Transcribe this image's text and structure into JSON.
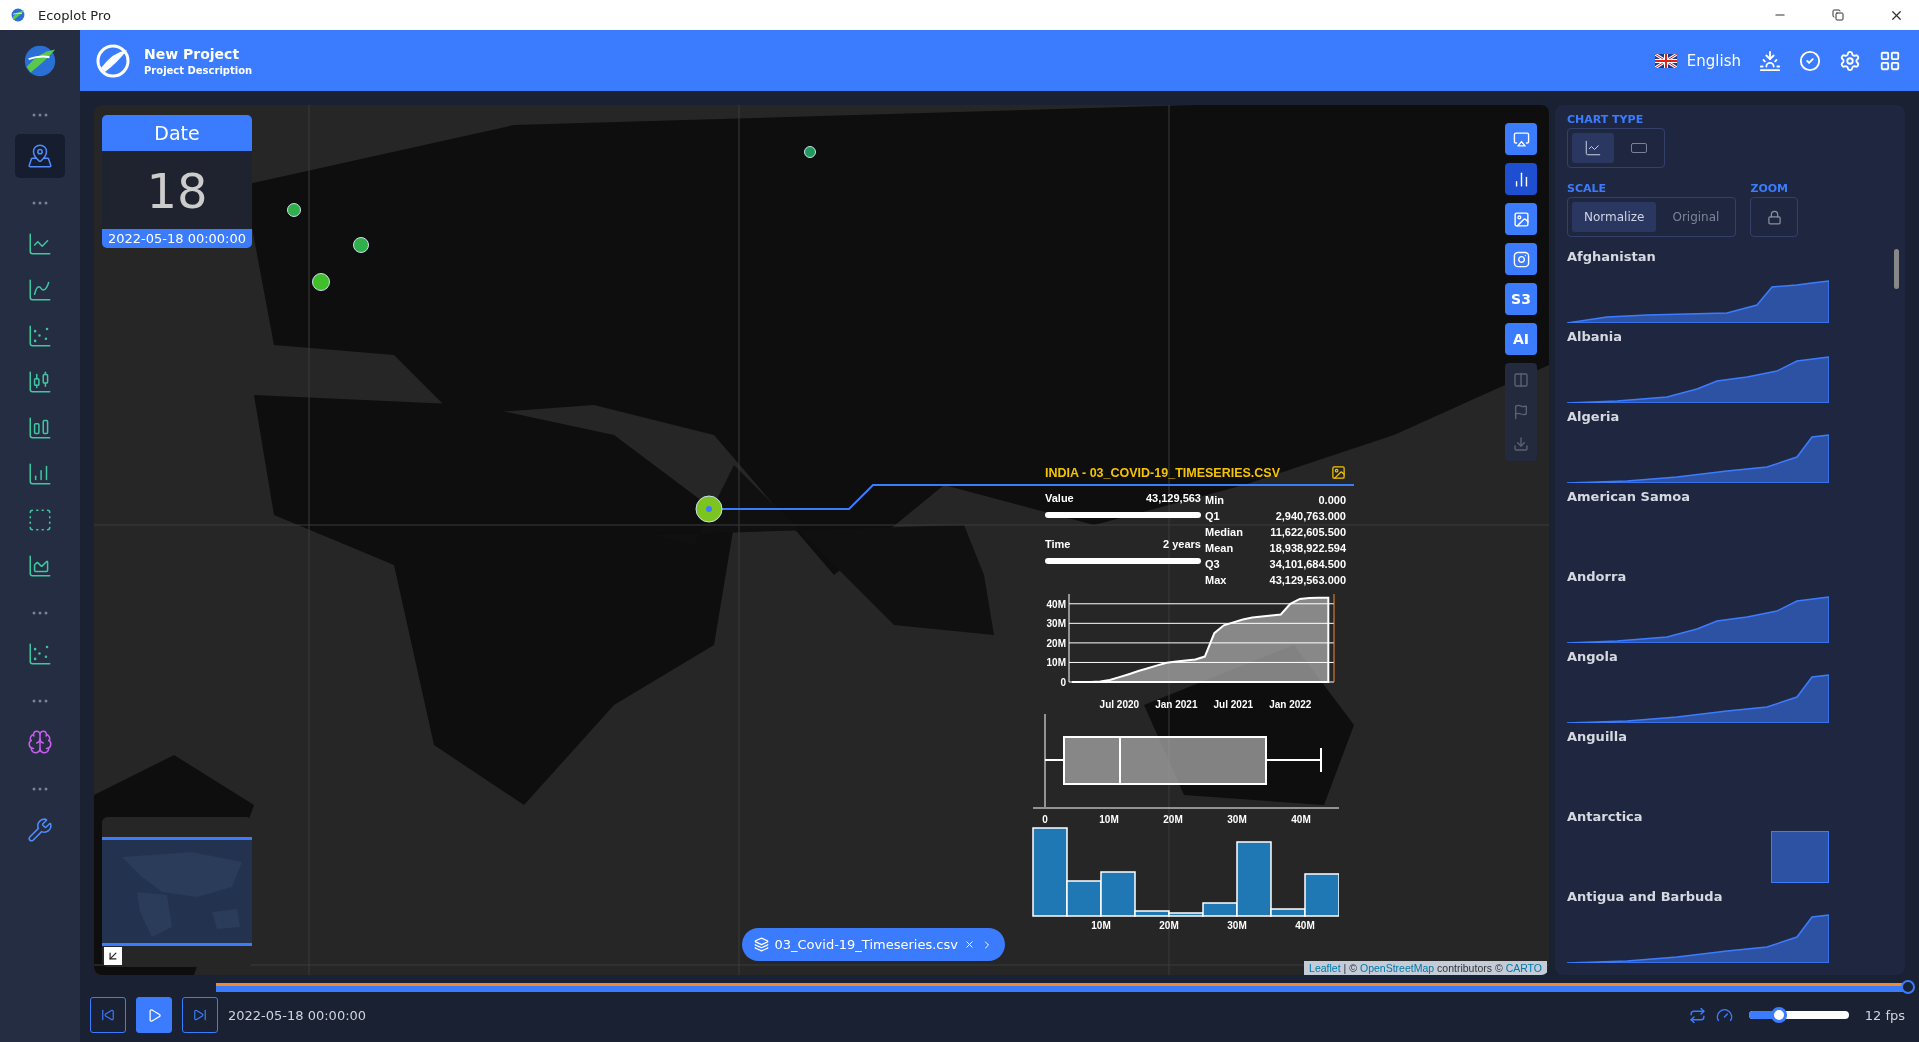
{
  "window": {
    "title": "Ecoplot Pro"
  },
  "sidebar": {
    "groups": [
      {
        "items": [
          {
            "selected": true
          }
        ]
      },
      {
        "items": [
          {
            "selected": false
          },
          {
            "selected": false
          },
          {
            "selected": false
          },
          {
            "selected": false
          },
          {
            "selected": false
          },
          {
            "selected": false
          },
          {
            "selected": false
          },
          {
            "selected": false
          }
        ]
      },
      {
        "items": [
          {
            "selected": false
          }
        ]
      },
      {
        "items": [
          {
            "selected": false
          }
        ]
      },
      {
        "items": [
          {
            "selected": false
          }
        ]
      }
    ]
  },
  "header": {
    "title": "New Project",
    "subtitle": "Project Description",
    "language": "English"
  },
  "date_card": {
    "label": "Date",
    "day": "18",
    "datetime": "2022-05-18 00:00:00"
  },
  "map_tools": [
    {
      "kind": "icon",
      "selected": false,
      "disabled": false
    },
    {
      "kind": "icon",
      "selected": true,
      "disabled": false
    },
    {
      "kind": "icon",
      "selected": false,
      "disabled": false
    },
    {
      "kind": "icon",
      "selected": false,
      "disabled": false
    },
    {
      "kind": "text",
      "label": "S3",
      "selected": false,
      "disabled": false
    },
    {
      "kind": "text",
      "label": "AI",
      "selected": false,
      "disabled": false
    },
    {
      "kind": "icon",
      "selected": false,
      "disabled": true
    },
    {
      "kind": "icon",
      "selected": false,
      "disabled": true
    },
    {
      "kind": "icon",
      "selected": false,
      "disabled": true
    }
  ],
  "tooltip": {
    "title": "INDIA - 03_COVID-19_TIMESERIES.CSV",
    "value_label": "Value",
    "value": "43,129,563",
    "time_label": "Time",
    "time": "2 years",
    "stats": [
      {
        "label": "Min",
        "value": "0.000"
      },
      {
        "label": "Q1",
        "value": "2,940,763.000"
      },
      {
        "label": "Median",
        "value": "11,622,605.500"
      },
      {
        "label": "Mean",
        "value": "18,938,922.594"
      },
      {
        "label": "Q3",
        "value": "34,101,684.500"
      },
      {
        "label": "Max",
        "value": "43,129,563.000"
      }
    ],
    "chart_data": {
      "type": "area",
      "categories": [
        null,
        null,
        null,
        null,
        null,
        "Jul 2020",
        null,
        null,
        null,
        null,
        null,
        "Jan 2021",
        null,
        null,
        null,
        null,
        null,
        "Jul 2021",
        null,
        null,
        null,
        null,
        null,
        "Jan 2022",
        null,
        null,
        null,
        null
      ],
      "values": [
        0,
        0,
        0,
        0.2,
        1,
        2.5,
        4,
        5.6,
        7,
        8.5,
        9.8,
        10.5,
        11,
        11.5,
        13,
        25,
        29,
        30.5,
        32,
        33,
        33.5,
        34,
        34.5,
        40,
        42.5,
        43,
        43.1,
        43.1
      ],
      "ylim": [
        0,
        45
      ],
      "grid": true,
      "yticks": [
        {
          "value": 0,
          "label": "0"
        },
        {
          "value": 10,
          "label": "10M"
        },
        {
          "value": 20,
          "label": "20M"
        },
        {
          "value": 30,
          "label": "30M"
        },
        {
          "value": 40,
          "label": "40M"
        }
      ]
    },
    "box_plot": {
      "ticks": [
        "0",
        "10M",
        "20M",
        "30M",
        "40M"
      ]
    },
    "histogram": {
      "ticks": [
        "10M",
        "20M",
        "30M",
        "40M"
      ]
    }
  },
  "layer_chip": {
    "label": "03_Covid-19_Timeseries.csv"
  },
  "attribution": {
    "links": [
      "Leaflet",
      "OpenStreetMap",
      "CARTO"
    ],
    "texts": [
      "| ©",
      "contributors ©"
    ]
  },
  "right_panel": {
    "chart_type_label": "CHART TYPE",
    "chart_types": [
      {
        "selected": true
      },
      {
        "selected": false
      }
    ],
    "scale_label": "SCALE",
    "scales": [
      {
        "label": "Normalize",
        "selected": true
      },
      {
        "label": "Original",
        "selected": false
      }
    ],
    "zoom_label": "ZOOM",
    "series": [
      {
        "name": "Afghanistan",
        "kind": "curve"
      },
      {
        "name": "Albania",
        "kind": "curve"
      },
      {
        "name": "Algeria",
        "kind": "curve"
      },
      {
        "name": "American Samoa",
        "kind": "none"
      },
      {
        "name": "Andorra",
        "kind": "curve"
      },
      {
        "name": "Angola",
        "kind": "curve"
      },
      {
        "name": "Anguilla",
        "kind": "none"
      },
      {
        "name": "Antarctica",
        "kind": "block"
      },
      {
        "name": "Antigua and Barbuda",
        "kind": "curve"
      }
    ]
  },
  "playback": {
    "datetime": "2022-05-18 00:00:00",
    "progress": {
      "level": 1
    },
    "speed": {
      "level": 0.3
    },
    "fps": "12 fps"
  }
}
